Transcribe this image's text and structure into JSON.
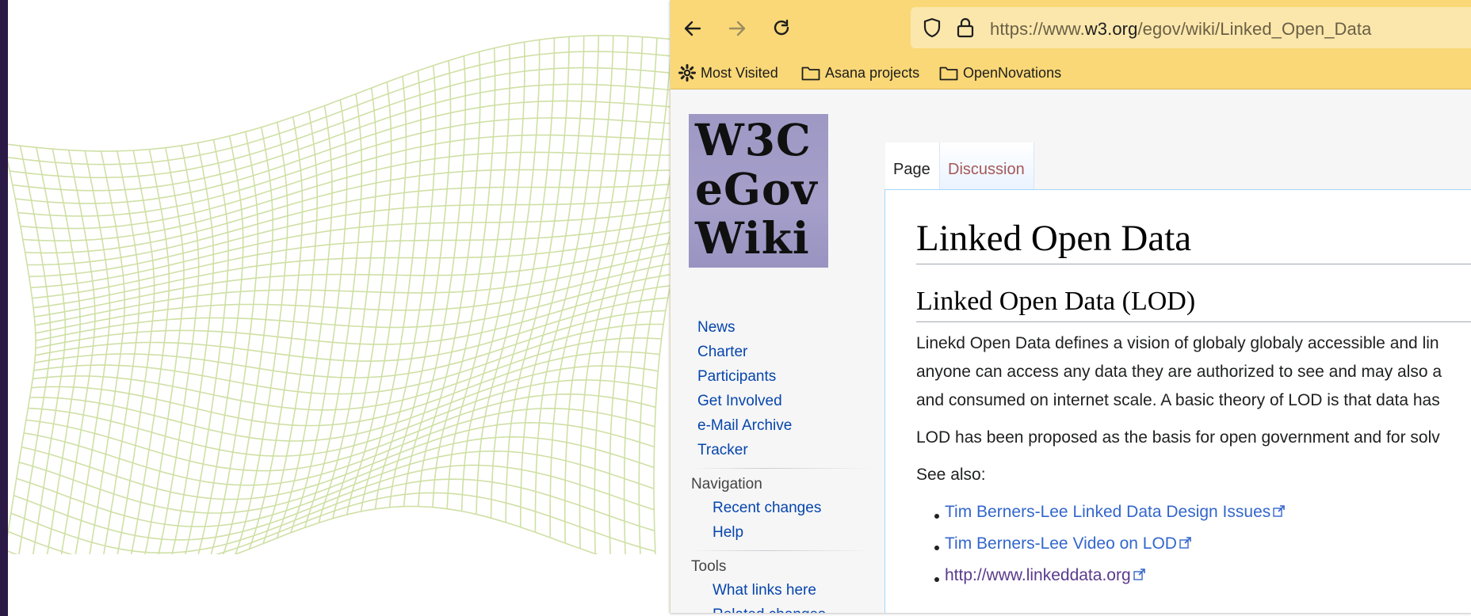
{
  "browser": {
    "url_prefix": "https://www.",
    "url_host": "w3.org",
    "url_path": "/egov/wiki/Linked_Open_Data",
    "bookmarks": [
      "Most Visited",
      "Asana projects",
      "OpenNovations"
    ]
  },
  "wiki": {
    "logo_text": "W3C\neGov\nWiki",
    "sidebar": {
      "links": [
        "News",
        "Charter",
        "Participants",
        "Get Involved",
        "e-Mail Archive",
        "Tracker"
      ],
      "navigation_heading": "Navigation",
      "navigation_links": [
        "Recent changes",
        "Help"
      ],
      "tools_heading": "Tools",
      "tools_links": [
        "What links here",
        "Related changes"
      ]
    },
    "tabs": [
      "Page",
      "Discussion"
    ],
    "title": "Linked Open Data",
    "section_heading": "Linked Open Data (LOD)",
    "paragraph_lines": [
      "Linekd Open Data defines a vision of globaly globaly accessible and lin",
      "anyone can access any data they are authorized to see and may also a",
      "and consumed on internet scale. A basic theory of LOD is that data has"
    ],
    "paragraph2": "LOD has been proposed as the basis for open government and for solv",
    "see_also": "See also:",
    "see_also_links": [
      "Tim Berners-Lee Linked Data Design Issues",
      "Tim Berners-Lee Video on LOD",
      "http://www.linkeddata.org"
    ]
  },
  "colors": {
    "toolbar": "#fad877",
    "link": "#0645ad",
    "wave_line": "#cfe0a5",
    "slide_left_bar": "#2b1a45"
  }
}
